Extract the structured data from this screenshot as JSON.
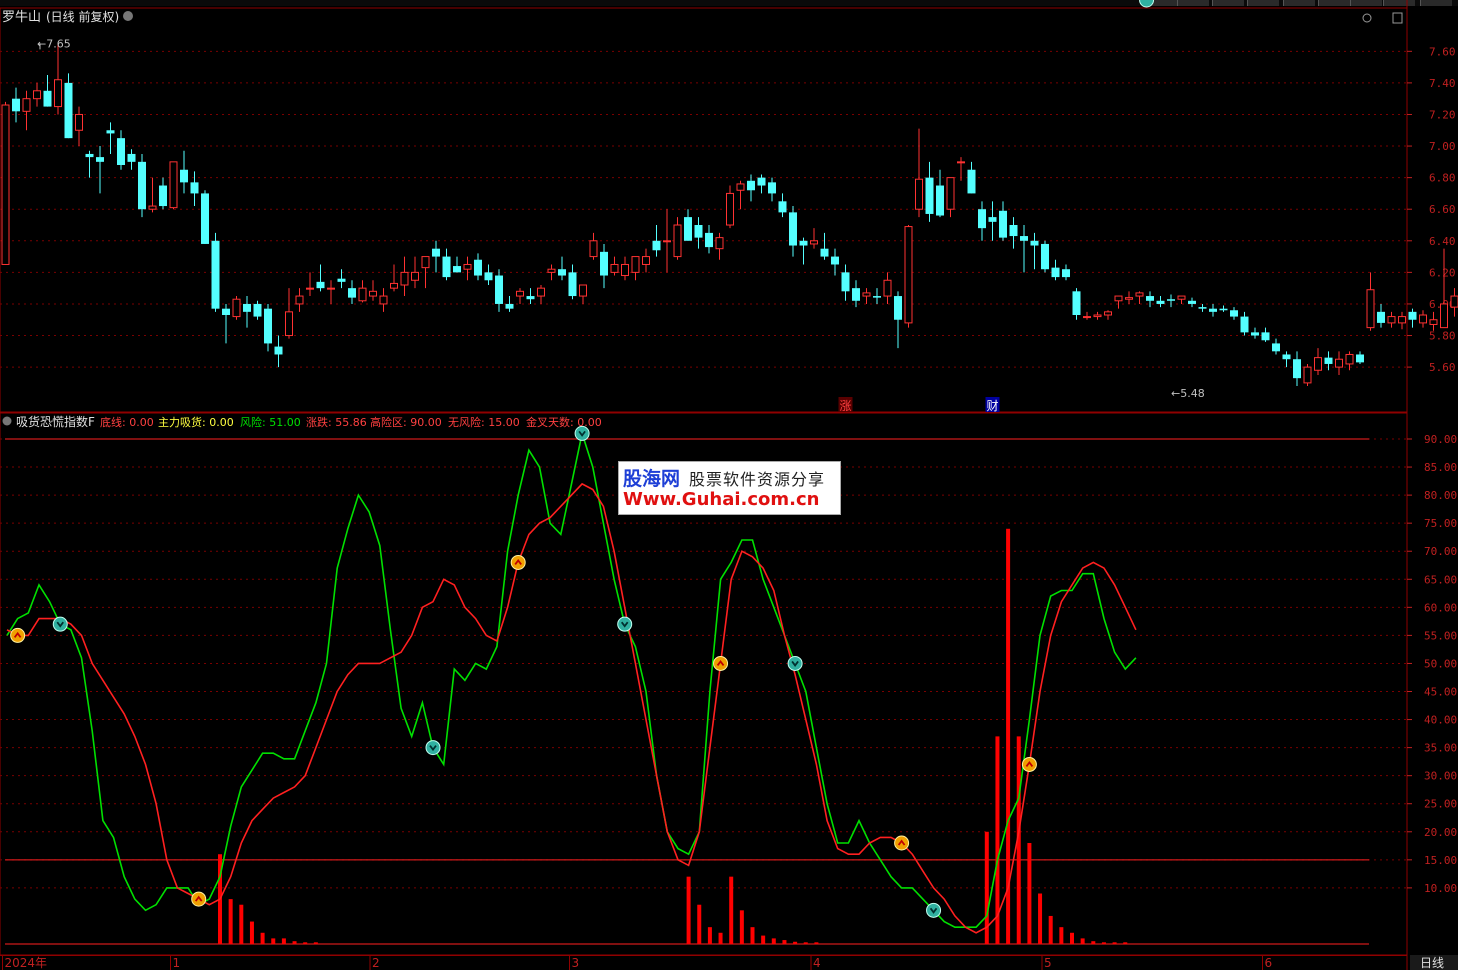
{
  "stock": {
    "name": "罗牛山",
    "period_label": "(日线 前复权)",
    "high_label": "7.65",
    "low_label": "5.48",
    "event_markers": [
      {
        "text": "涨",
        "color": "#ff4040",
        "bg": "#5a0000",
        "bar": 80
      },
      {
        "text": "财",
        "color": "#ffffff",
        "bg": "#0000a0",
        "bar": 94
      }
    ]
  },
  "price_axis": {
    "ticks": [
      "7.60",
      "7.40",
      "7.20",
      "7.00",
      "6.80",
      "6.60",
      "6.40",
      "6.20",
      "6.00",
      "5.80",
      "5.60"
    ],
    "min": 5.36,
    "max": 7.83
  },
  "indicator": {
    "title": "吸货恐慌指数F",
    "legend": [
      {
        "text": "底线: 0.00",
        "color": "#ff4040"
      },
      {
        "text": "主力吸货: 0.00",
        "color": "#ffff40"
      },
      {
        "text": "风险: 51.00",
        "color": "#00e000"
      },
      {
        "text": "涨跌: 55.86",
        "color": "#ff4040"
      },
      {
        "text": "高险区: 90.00",
        "color": "#ff4040"
      },
      {
        "text": "无风险: 15.00",
        "color": "#ff4040"
      },
      {
        "text": "金叉天数: 0.00",
        "color": "#ff4040"
      }
    ],
    "ticks": [
      "90.00",
      "85.00",
      "80.00",
      "75.00",
      "70.00",
      "65.00",
      "60.00",
      "55.00",
      "50.00",
      "45.00",
      "40.00",
      "35.00",
      "30.00",
      "25.00",
      "20.00",
      "15.00",
      "10.00"
    ],
    "min": 0,
    "max": 94
  },
  "date_axis": {
    "labels": [
      {
        "text": "2024年",
        "bar": 0
      },
      {
        "text": "1",
        "bar": 16
      },
      {
        "text": "2",
        "bar": 35
      },
      {
        "text": "3",
        "bar": 54
      },
      {
        "text": "4",
        "bar": 77
      },
      {
        "text": "5",
        "bar": 99
      },
      {
        "text": "6",
        "bar": 120
      }
    ]
  },
  "bottom_tab": "日线",
  "watermark": {
    "brand": "股海网",
    "tagline": "股票软件资源分享",
    "url": "Www.Guhai.com.cn"
  },
  "colors": {
    "up": "#ff3232",
    "down": "#54ffff",
    "green_line": "#00e000",
    "red_line": "#ff2020",
    "grid": "#7a0000",
    "axis_text": "#c02020"
  },
  "chart_data": [
    {
      "type": "candlestick",
      "title": "罗牛山",
      "ylim": [
        5.36,
        7.83
      ],
      "ohlc": [
        [
          6.25,
          7.28,
          6.25,
          7.26
        ],
        [
          7.3,
          7.37,
          7.15,
          7.22
        ],
        [
          7.22,
          7.35,
          7.1,
          7.3
        ],
        [
          7.3,
          7.4,
          7.25,
          7.35
        ],
        [
          7.35,
          7.45,
          7.25,
          7.25
        ],
        [
          7.25,
          7.65,
          7.2,
          7.42
        ],
        [
          7.4,
          7.46,
          7.05,
          7.05
        ],
        [
          7.1,
          7.25,
          7.0,
          7.2
        ],
        [
          6.95,
          6.97,
          6.8,
          6.93
        ],
        [
          6.93,
          7.0,
          6.7,
          6.9
        ],
        [
          7.1,
          7.15,
          6.95,
          7.08
        ],
        [
          7.05,
          7.1,
          6.85,
          6.88
        ],
        [
          6.95,
          6.98,
          6.85,
          6.9
        ],
        [
          6.9,
          6.95,
          6.55,
          6.6
        ],
        [
          6.6,
          6.8,
          6.58,
          6.62
        ],
        [
          6.75,
          6.8,
          6.6,
          6.62
        ],
        [
          6.61,
          6.9,
          6.6,
          6.9
        ],
        [
          6.85,
          6.97,
          6.7,
          6.77
        ],
        [
          6.77,
          6.84,
          6.62,
          6.7
        ],
        [
          6.7,
          6.72,
          6.38,
          6.38
        ],
        [
          6.4,
          6.45,
          5.95,
          5.97
        ],
        [
          5.97,
          6.0,
          5.75,
          5.93
        ],
        [
          5.92,
          6.05,
          5.9,
          6.03
        ],
        [
          6.0,
          6.05,
          5.85,
          5.95
        ],
        [
          6.0,
          6.02,
          5.9,
          5.92
        ],
        [
          5.97,
          6.0,
          5.7,
          5.75
        ],
        [
          5.73,
          5.8,
          5.6,
          5.68
        ],
        [
          5.8,
          6.1,
          5.78,
          5.95
        ],
        [
          6.0,
          6.1,
          5.95,
          6.05
        ],
        [
          6.1,
          6.2,
          6.05,
          6.1
        ],
        [
          6.14,
          6.25,
          6.08,
          6.1
        ],
        [
          6.1,
          6.15,
          6.0,
          6.1
        ],
        [
          6.16,
          6.22,
          6.1,
          6.14
        ],
        [
          6.1,
          6.15,
          6.0,
          6.04
        ],
        [
          6.02,
          6.15,
          6.01,
          6.1
        ],
        [
          6.05,
          6.15,
          6.02,
          6.08
        ],
        [
          6.0,
          6.1,
          5.95,
          6.05
        ],
        [
          6.1,
          6.25,
          6.08,
          6.13
        ],
        [
          6.12,
          6.3,
          6.05,
          6.2
        ],
        [
          6.15,
          6.3,
          6.1,
          6.2
        ],
        [
          6.23,
          6.3,
          6.1,
          6.3
        ],
        [
          6.35,
          6.4,
          6.2,
          6.3
        ],
        [
          6.3,
          6.35,
          6.15,
          6.17
        ],
        [
          6.24,
          6.3,
          6.2,
          6.2
        ],
        [
          6.22,
          6.3,
          6.15,
          6.25
        ],
        [
          6.28,
          6.32,
          6.15,
          6.18
        ],
        [
          6.2,
          6.25,
          6.12,
          6.15
        ],
        [
          6.18,
          6.22,
          5.95,
          6.0
        ],
        [
          6.0,
          6.05,
          5.95,
          5.97
        ],
        [
          6.05,
          6.1,
          6.0,
          6.08
        ],
        [
          6.05,
          6.1,
          6.0,
          6.03
        ],
        [
          6.05,
          6.12,
          6.0,
          6.1
        ],
        [
          6.2,
          6.25,
          6.15,
          6.22
        ],
        [
          6.22,
          6.3,
          6.15,
          6.18
        ],
        [
          6.2,
          6.25,
          6.03,
          6.05
        ],
        [
          6.05,
          6.12,
          6.0,
          6.12
        ],
        [
          6.3,
          6.45,
          6.28,
          6.4
        ],
        [
          6.33,
          6.38,
          6.1,
          6.18
        ],
        [
          6.2,
          6.3,
          6.18,
          6.25
        ],
        [
          6.18,
          6.3,
          6.15,
          6.25
        ],
        [
          6.2,
          6.3,
          6.15,
          6.3
        ],
        [
          6.25,
          6.35,
          6.2,
          6.3
        ],
        [
          6.4,
          6.5,
          6.3,
          6.34
        ],
        [
          6.4,
          6.6,
          6.2,
          6.4
        ],
        [
          6.3,
          6.55,
          6.28,
          6.5
        ],
        [
          6.55,
          6.6,
          6.4,
          6.4
        ],
        [
          6.5,
          6.55,
          6.35,
          6.42
        ],
        [
          6.45,
          6.5,
          6.32,
          6.36
        ],
        [
          6.35,
          6.45,
          6.28,
          6.42
        ],
        [
          6.5,
          6.75,
          6.48,
          6.7
        ],
        [
          6.72,
          6.78,
          6.6,
          6.76
        ],
        [
          6.78,
          6.82,
          6.65,
          6.72
        ],
        [
          6.8,
          6.82,
          6.7,
          6.75
        ],
        [
          6.77,
          6.8,
          6.65,
          6.7
        ],
        [
          6.65,
          6.7,
          6.55,
          6.58
        ],
        [
          6.58,
          6.62,
          6.3,
          6.37
        ],
        [
          6.4,
          6.42,
          6.25,
          6.37
        ],
        [
          6.38,
          6.48,
          6.35,
          6.4
        ],
        [
          6.35,
          6.45,
          6.28,
          6.3
        ],
        [
          6.3,
          6.35,
          6.18,
          6.25
        ],
        [
          6.2,
          6.25,
          6.02,
          6.08
        ],
        [
          6.1,
          6.15,
          5.98,
          6.02
        ],
        [
          6.05,
          6.1,
          6.0,
          6.07
        ],
        [
          6.05,
          6.1,
          6.0,
          6.04
        ],
        [
          6.05,
          6.2,
          6.0,
          6.15
        ],
        [
          6.05,
          6.08,
          5.72,
          5.9
        ],
        [
          5.88,
          6.5,
          5.85,
          6.49
        ],
        [
          6.6,
          7.11,
          6.55,
          6.79
        ],
        [
          6.8,
          6.9,
          6.52,
          6.57
        ],
        [
          6.75,
          6.85,
          6.55,
          6.56
        ],
        [
          6.6,
          6.8,
          6.55,
          6.8
        ],
        [
          6.9,
          6.93,
          6.78,
          6.9
        ],
        [
          6.85,
          6.9,
          6.7,
          6.7
        ],
        [
          6.6,
          6.65,
          6.4,
          6.48
        ],
        [
          6.55,
          6.65,
          6.4,
          6.52
        ],
        [
          6.59,
          6.65,
          6.4,
          6.42
        ],
        [
          6.5,
          6.55,
          6.35,
          6.43
        ],
        [
          6.43,
          6.5,
          6.2,
          6.4
        ],
        [
          6.4,
          6.45,
          6.22,
          6.37
        ],
        [
          6.38,
          6.4,
          6.2,
          6.22
        ],
        [
          6.23,
          6.28,
          6.15,
          6.17
        ],
        [
          6.22,
          6.25,
          6.15,
          6.17
        ],
        [
          6.08,
          6.1,
          5.9,
          5.93
        ],
        [
          5.92,
          5.95,
          5.9,
          5.92
        ],
        [
          5.92,
          5.95,
          5.9,
          5.93
        ],
        [
          5.93,
          5.96,
          5.9,
          5.95
        ],
        [
          6.02,
          6.05,
          5.97,
          6.05
        ],
        [
          6.03,
          6.08,
          6.0,
          6.04
        ],
        [
          6.05,
          6.08,
          6.0,
          6.07
        ],
        [
          6.05,
          6.08,
          5.98,
          6.02
        ],
        [
          6.02,
          6.05,
          5.98,
          6.0
        ],
        [
          6.03,
          6.06,
          5.98,
          6.02
        ],
        [
          6.03,
          6.05,
          6.0,
          6.05
        ],
        [
          6.02,
          6.04,
          5.98,
          6.0
        ],
        [
          5.98,
          6.0,
          5.95,
          5.97
        ],
        [
          5.97,
          6.0,
          5.92,
          5.95
        ],
        [
          5.97,
          5.99,
          5.95,
          5.96
        ],
        [
          5.96,
          5.98,
          5.9,
          5.92
        ],
        [
          5.92,
          5.95,
          5.8,
          5.82
        ],
        [
          5.82,
          5.85,
          5.78,
          5.8
        ],
        [
          5.82,
          5.85,
          5.76,
          5.77
        ],
        [
          5.75,
          5.78,
          5.68,
          5.7
        ],
        [
          5.68,
          5.7,
          5.6,
          5.65
        ],
        [
          5.65,
          5.7,
          5.48,
          5.53
        ],
        [
          5.5,
          5.62,
          5.48,
          5.6
        ],
        [
          5.58,
          5.72,
          5.55,
          5.66
        ],
        [
          5.66,
          5.7,
          5.58,
          5.62
        ],
        [
          5.6,
          5.7,
          5.55,
          5.65
        ],
        [
          5.62,
          5.7,
          5.58,
          5.68
        ],
        [
          5.68,
          5.7,
          5.62,
          5.63
        ],
        [
          5.85,
          6.2,
          5.83,
          6.09
        ],
        [
          5.95,
          6.0,
          5.85,
          5.88
        ],
        [
          5.88,
          5.95,
          5.85,
          5.92
        ],
        [
          5.88,
          5.95,
          5.84,
          5.92
        ],
        [
          5.95,
          5.97,
          5.85,
          5.9
        ],
        [
          5.88,
          5.96,
          5.85,
          5.93
        ],
        [
          5.87,
          5.95,
          5.83,
          5.9
        ],
        [
          5.85,
          6.35,
          5.85,
          6.0
        ],
        [
          5.98,
          6.1,
          5.92,
          6.05
        ],
        [
          6.05,
          6.1,
          5.95,
          6.0
        ],
        [
          6.03,
          6.15,
          5.95,
          6.02
        ],
        [
          5.95,
          6.0,
          5.83,
          5.88
        ],
        [
          5.88,
          5.95,
          5.85,
          5.9
        ],
        [
          5.85,
          5.95,
          5.76,
          5.93
        ],
        [
          5.9,
          5.98,
          5.87,
          5.96
        ]
      ]
    },
    {
      "type": "line",
      "title": "吸货恐慌指数F",
      "ylim": [
        0,
        94
      ],
      "reference_lines": [
        90,
        15,
        0
      ],
      "series": [
        {
          "name": "风险",
          "color": "#00e000",
          "values": [
            55,
            58,
            59,
            64,
            61,
            57,
            56,
            51,
            38,
            22,
            19,
            12,
            8,
            6,
            7,
            10,
            10,
            10,
            7,
            8,
            12,
            21,
            28,
            31,
            34,
            34,
            33,
            33,
            38,
            43,
            50,
            67,
            74,
            80,
            77,
            71,
            56,
            42,
            37,
            43,
            35,
            32,
            49,
            47,
            50,
            49,
            53,
            70,
            80,
            88,
            85,
            75,
            73,
            82,
            91,
            85,
            75,
            65,
            57,
            53,
            45,
            30,
            20,
            17,
            16,
            20,
            45,
            65,
            68,
            72,
            72,
            65,
            60,
            55,
            50,
            45,
            35,
            25,
            18,
            18,
            22,
            18,
            15,
            12,
            10,
            10,
            8,
            6,
            4,
            3,
            3,
            3,
            5,
            15,
            22,
            26,
            40,
            55,
            62,
            63,
            63,
            66,
            66,
            58,
            52,
            49,
            51
          ]
        },
        {
          "name": "涨跌",
          "color": "#ff2020",
          "values": [
            56,
            55,
            55,
            58,
            58,
            58,
            57,
            55,
            50,
            47,
            44,
            41,
            37,
            32,
            25,
            15,
            10,
            9,
            8,
            7,
            8,
            12,
            18,
            22,
            24,
            26,
            27,
            28,
            30,
            35,
            40,
            45,
            48,
            50,
            50,
            50,
            51,
            52,
            55,
            60,
            61,
            65,
            64,
            60,
            58,
            55,
            54,
            60,
            68,
            73,
            75,
            76,
            78,
            80,
            82,
            81,
            78,
            70,
            60,
            50,
            40,
            30,
            20,
            15,
            14,
            20,
            35,
            50,
            65,
            70,
            69,
            67,
            63,
            55,
            48,
            40,
            32,
            22,
            17,
            16,
            16,
            18,
            19,
            19,
            18,
            16,
            13,
            10,
            8,
            5,
            3,
            2,
            3,
            5,
            10,
            20,
            32,
            45,
            55,
            61,
            64,
            67,
            68,
            67,
            64,
            60,
            56
          ]
        }
      ],
      "bars": {
        "name": "主力吸货",
        "color": "#ff0000",
        "values": {
          "20": 16,
          "21": 8,
          "22": 7,
          "23": 4,
          "24": 2,
          "25": 1,
          "26": 1,
          "27": 0.5,
          "28": 0.3,
          "29": 0.3,
          "64": 12,
          "65": 7,
          "66": 3,
          "67": 2,
          "68": 12,
          "69": 6,
          "70": 3,
          "71": 1.5,
          "72": 1,
          "73": 0.7,
          "74": 0.4,
          "75": 0.3,
          "76": 0.3,
          "92": 20,
          "93": 37,
          "94": 74,
          "95": 37,
          "96": 18,
          "97": 9,
          "98": 5,
          "99": 3,
          "100": 2,
          "101": 1,
          "102": 0.5,
          "103": 0.3,
          "104": 0.3,
          "105": 0.3
        }
      },
      "signals_up": [
        1,
        18,
        48,
        67,
        84,
        96
      ],
      "signals_down": [
        5,
        40,
        54,
        58,
        74,
        87,
        107
      ]
    }
  ]
}
